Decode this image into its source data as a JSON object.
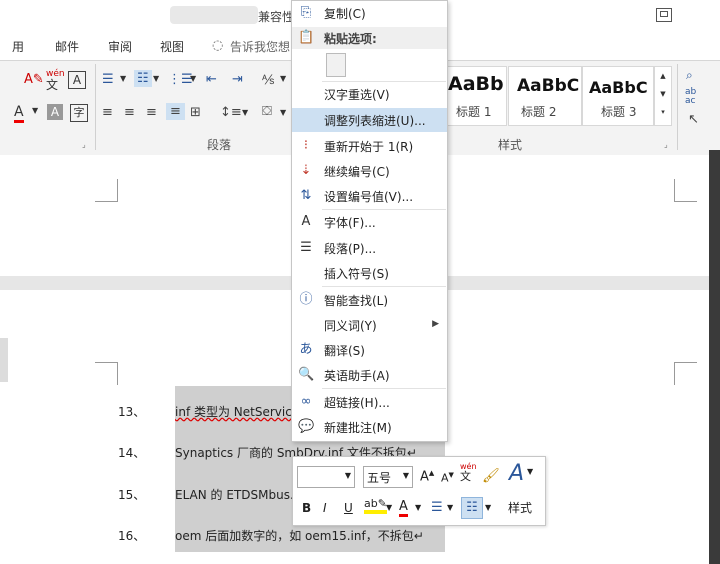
{
  "window": {
    "title_fragment": "兼容性"
  },
  "tabs": [
    {
      "label": "用"
    },
    {
      "label": "邮件"
    },
    {
      "label": "审阅"
    },
    {
      "label": "视图"
    },
    {
      "label": "告诉我您想"
    }
  ],
  "ribbon": {
    "paragraph_label": "段落",
    "styles_label": "样式",
    "styles": [
      {
        "sample": "AaBb",
        "name": "标题 1"
      },
      {
        "sample": "AaBbC",
        "name": "标题 2"
      },
      {
        "sample": "AaBbC",
        "name": "标题 3"
      }
    ],
    "wen_label": "wén",
    "wen_char": "文"
  },
  "context_menu": {
    "copy": "复制(C)",
    "paste_options": "粘贴选项:",
    "items": [
      {
        "label": "汉字重选(V)",
        "icon": "none-icon"
      },
      {
        "label": "调整列表缩进(U)...",
        "icon": "none-icon",
        "highlighted": true
      },
      {
        "label": "重新开始于 1(R)",
        "icon": "restart-numbering-icon"
      },
      {
        "label": "继续编号(C)",
        "icon": "continue-numbering-icon"
      },
      {
        "label": "设置编号值(V)...",
        "icon": "set-number-value-icon"
      },
      {
        "label": "字体(F)...",
        "icon": "font-icon"
      },
      {
        "label": "段落(P)...",
        "icon": "paragraph-icon"
      },
      {
        "label": "插入符号(S)",
        "icon": "none-icon"
      },
      {
        "label": "智能查找(L)",
        "icon": "smart-lookup-icon"
      },
      {
        "label": "同义词(Y)",
        "icon": "none-icon",
        "submenu": true
      },
      {
        "label": "翻译(S)",
        "icon": "translate-icon"
      },
      {
        "label": "英语助手(A)",
        "icon": "english-assistant-icon"
      },
      {
        "label": "超链接(H)...",
        "icon": "hyperlink-icon"
      },
      {
        "label": "新建批注(M)",
        "icon": "new-comment-icon"
      }
    ]
  },
  "mini_toolbar": {
    "font_name": "",
    "font_size": "五号",
    "style_label": "样式",
    "wen_label": "wén",
    "wen_char": "文"
  },
  "document": {
    "list": [
      {
        "num": "13、",
        "text": "inf 类型为 NetServic"
      },
      {
        "num": "14、",
        "text": "Synaptics 厂商的 SmbDrv.inf 文件不拆包↵"
      },
      {
        "num": "15、",
        "text": "ELAN 的 ETDSMbus."
      },
      {
        "num": "16、",
        "text": "oem 后面加数字的，如 oem15.inf，不拆包↵"
      }
    ]
  }
}
